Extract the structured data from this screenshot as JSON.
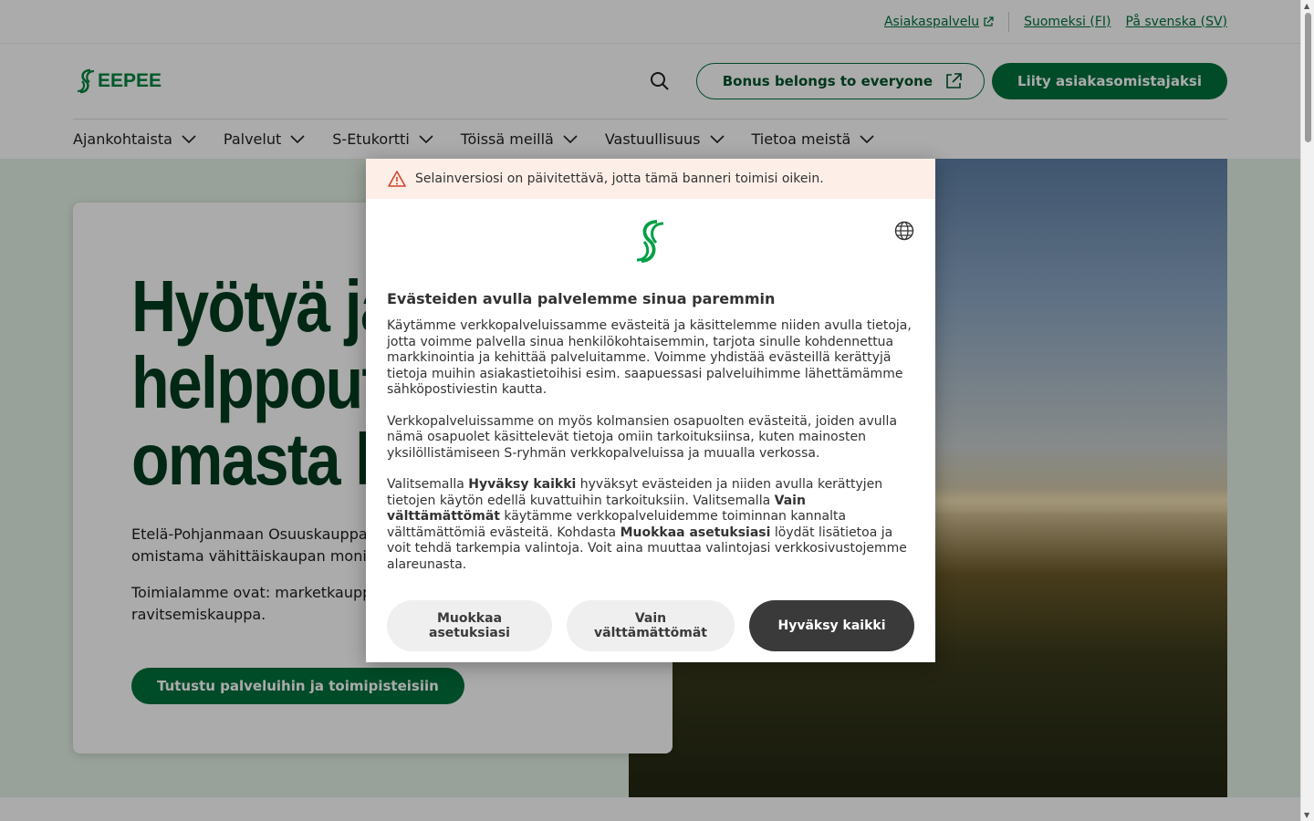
{
  "utility": {
    "customer_service": "Asiakaspalvelu",
    "lang_fi": "Suomeksi (FI)",
    "lang_sv": "På svenska (SV)"
  },
  "header": {
    "logo_text": "EEPEE",
    "bonus_button": "Bonus belongs to everyone",
    "join_button": "Liity asiakasomistajaksi"
  },
  "nav": {
    "items": [
      "Ajankohtaista",
      "Palvelut",
      "S-Etukortti",
      "Töissä meillä",
      "Vastuullisuus",
      "Tietoa meistä"
    ]
  },
  "hero": {
    "title": "Hyötyä ja\nhelppout\nomasta k",
    "text1": "Etelä-Pohjanmaan Osuuskauppa, E\nomistama vähittäiskaupan moniala",
    "text2": "Toimialamme ovat: marketkauppa,\nravitsemiskauppa.",
    "cta": "Tutustu palveluihin ja toimipisteisiin"
  },
  "cookie": {
    "warning": "Selainversiosi on päivitettävä, jotta tämä banneri toimisi oikein.",
    "title": "Evästeiden avulla palvelemme sinua paremmin",
    "para1": "Käytämme verkkopalveluissamme evästeitä ja käsittelemme niiden avulla tietoja, jotta voimme palvella sinua henkilökohtaisemmin, tarjota sinulle kohdennettua markkinointia ja kehittää palveluitamme. Voimme yhdistää evästeillä kerättyjä tietoja muihin asiakastietoihisi esim. saapuessasi palveluihimme lähettämämme sähköpostiviestin kautta.",
    "para2": "Verkkopalveluissamme on myös kolmansien osapuolten evästeitä, joiden avulla nämä osapuolet käsittelevät tietoja omiin tarkoituksiinsa, kuten mainosten yksilöllistämiseen S-ryhmän verkkopalveluissa ja muualla verkossa.",
    "para3_a": "Valitsemalla ",
    "para3_b": "Hyväksy kaikki",
    "para3_c": " hyväksyt evästeiden ja niiden avulla kerättyjen tietojen käytön edellä kuvattuihin tarkoituksiin. Valitsemalla ",
    "para3_d": "Vain välttämättömät",
    "para3_e": " käytämme verkkopalveluidemme toiminnan kannalta välttämättömiä evästeitä. Kohdasta ",
    "para3_f": "Muokkaa asetuksiasi",
    "para3_g": " löydät lisätietoa ja voit tehdä tarkempia valintoja. Voit aina muuttaa valintojasi verkkosivustojemme alareunasta.",
    "btn_customize": "Muokkaa asetuksiasi",
    "btn_necessary": "Vain välttämättömät",
    "btn_accept": "Hyväksy kaikki"
  },
  "colors": {
    "brand_green": "#00703c",
    "dark_button": "#3a3a3a",
    "warning_bg": "#fdeee8"
  }
}
